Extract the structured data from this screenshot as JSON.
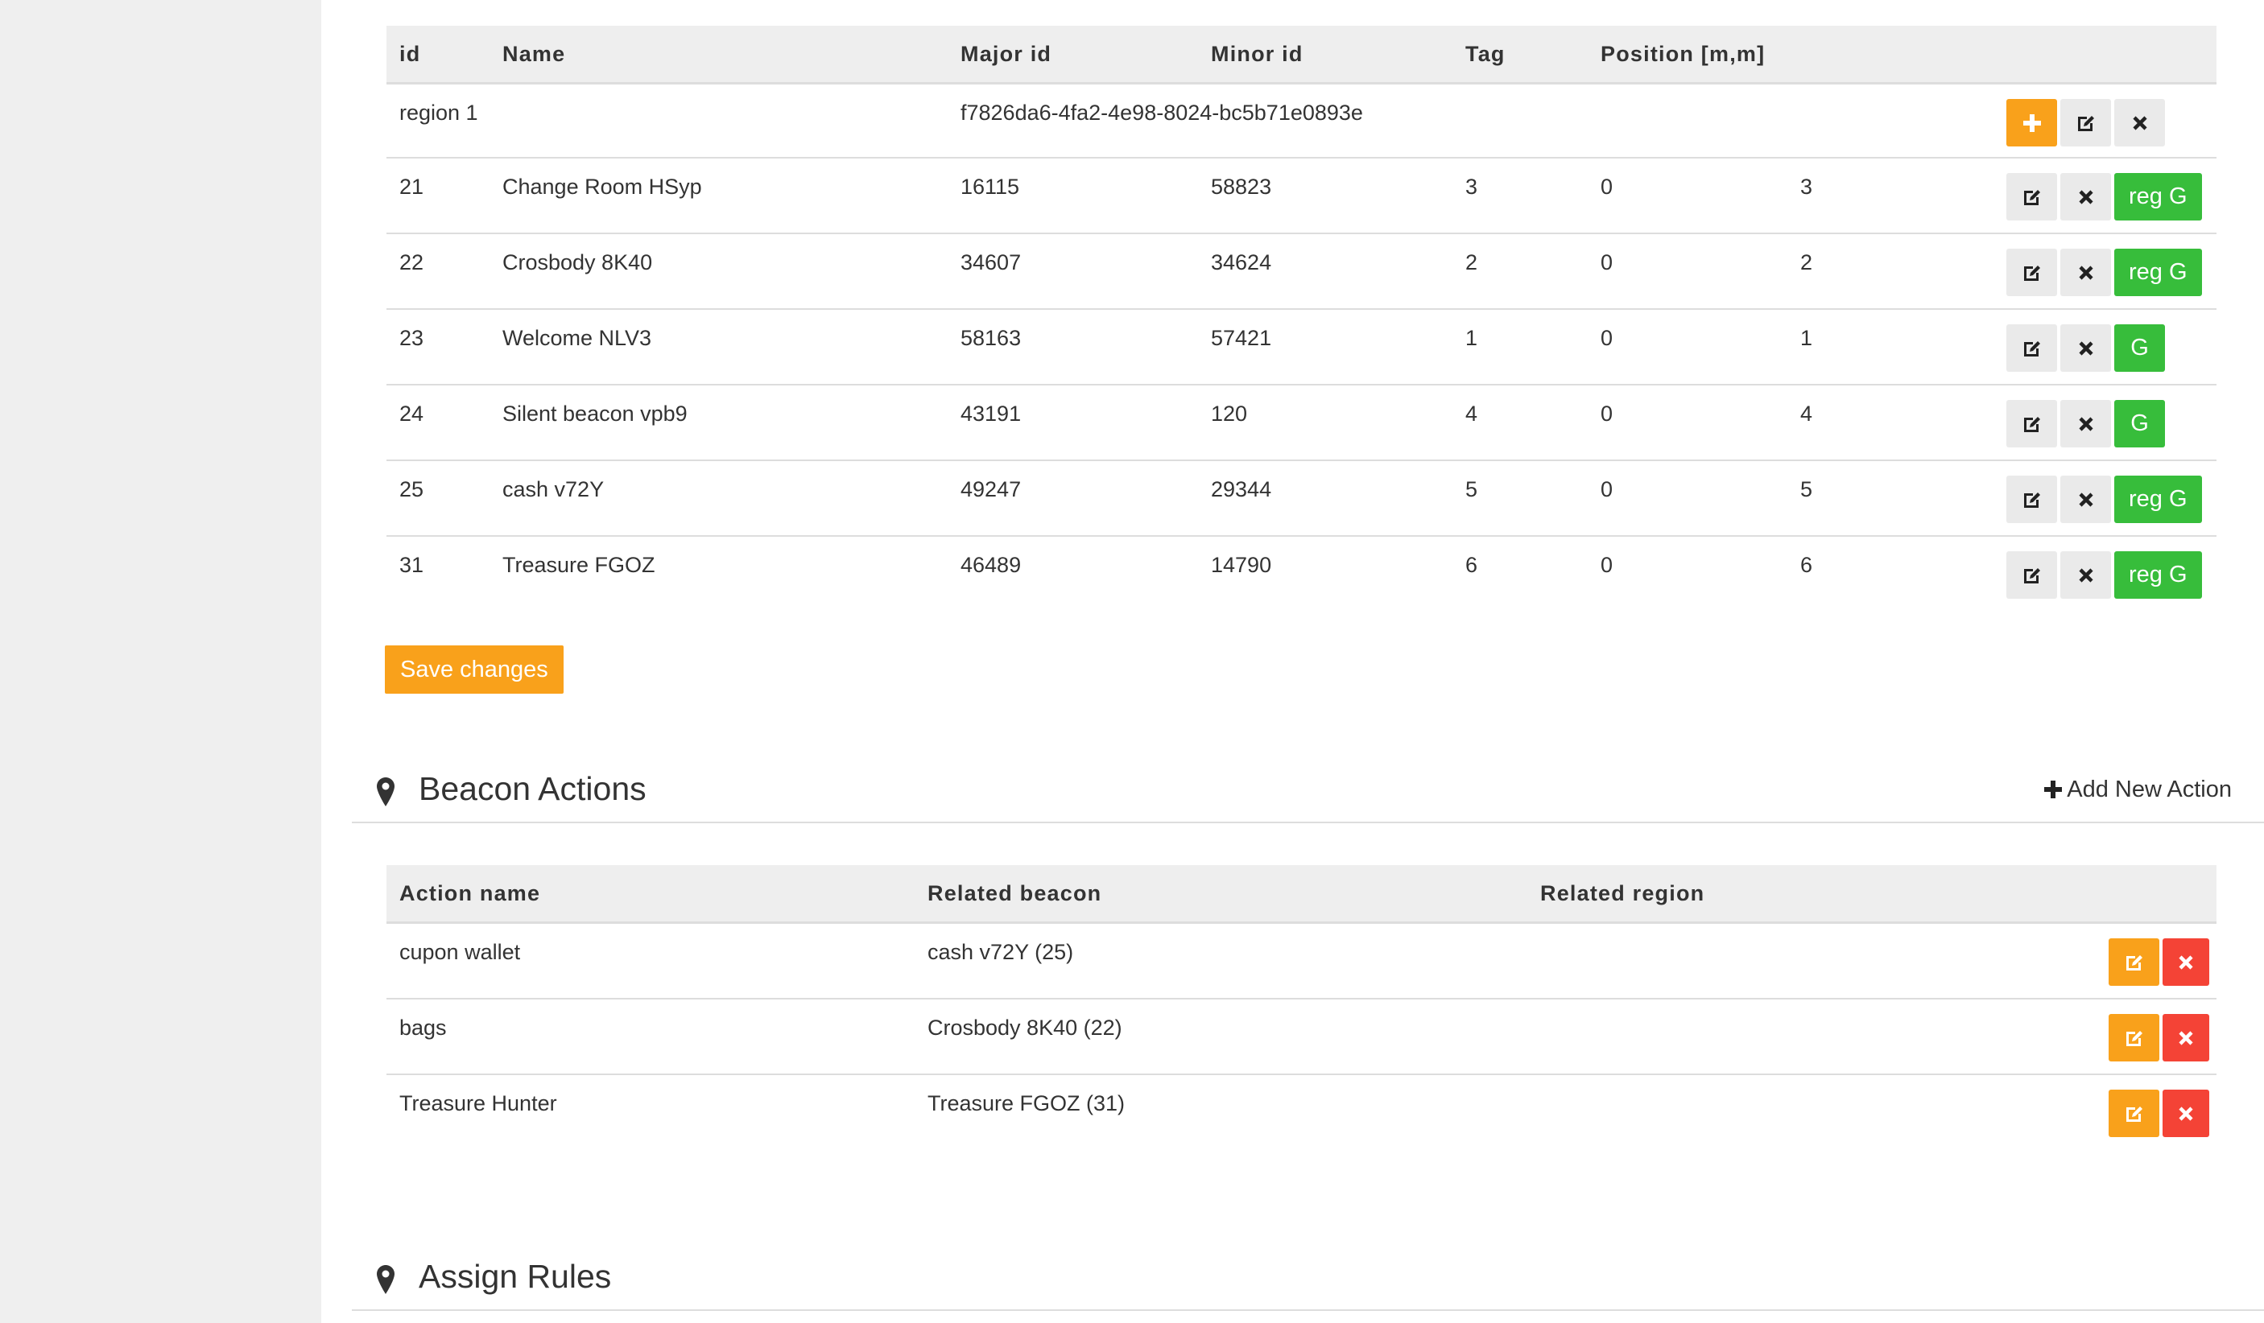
{
  "beacons_table": {
    "headers": {
      "id": "id",
      "name": "Name",
      "major": "Major id",
      "minor": "Minor id",
      "tag": "Tag",
      "position": "Position [m,m]"
    },
    "region_row": {
      "id": "region 1",
      "uuid": "f7826da6-4fa2-4e98-8024-bc5b71e0893e"
    },
    "rows": [
      {
        "id": "21",
        "name": "Change Room HSyp",
        "major": "16115",
        "minor": "58823",
        "tag": "3",
        "pos_x": "0",
        "pos_y": "3",
        "group_label": "reg G"
      },
      {
        "id": "22",
        "name": "Crosbody 8K40",
        "major": "34607",
        "minor": "34624",
        "tag": "2",
        "pos_x": "0",
        "pos_y": "2",
        "group_label": "reg G"
      },
      {
        "id": "23",
        "name": "Welcome NLV3",
        "major": "58163",
        "minor": "57421",
        "tag": "1",
        "pos_x": "0",
        "pos_y": "1",
        "group_label": "G"
      },
      {
        "id": "24",
        "name": "Silent beacon vpb9",
        "major": "43191",
        "minor": "120",
        "tag": "4",
        "pos_x": "0",
        "pos_y": "4",
        "group_label": "G"
      },
      {
        "id": "25",
        "name": "cash v72Y",
        "major": "49247",
        "minor": "29344",
        "tag": "5",
        "pos_x": "0",
        "pos_y": "5",
        "group_label": "reg G"
      },
      {
        "id": "31",
        "name": "Treasure FGOZ",
        "major": "46489",
        "minor": "14790",
        "tag": "6",
        "pos_x": "0",
        "pos_y": "6",
        "group_label": "reg G"
      }
    ]
  },
  "save_button": "Save changes",
  "beacon_actions": {
    "title": "Beacon Actions",
    "add_label": "Add New Action",
    "headers": {
      "action": "Action name",
      "beacon": "Related beacon",
      "region": "Related region"
    },
    "rows": [
      {
        "action": "cupon wallet",
        "beacon": "cash v72Y (25)",
        "region": ""
      },
      {
        "action": "bags",
        "beacon": "Crosbody 8K40 (22)",
        "region": ""
      },
      {
        "action": "Treasure Hunter",
        "beacon": "Treasure FGOZ (31)",
        "region": ""
      }
    ]
  },
  "assign_rules": {
    "title": "Assign Rules"
  },
  "colors": {
    "accent_orange": "#f9a11b",
    "success_green": "#37bd3b",
    "danger_red": "#f44336",
    "sidebar": "#efefef"
  },
  "icons": {
    "add": "plus-icon",
    "edit": "edit-icon",
    "delete": "close-icon",
    "section": "map-marker-icon"
  }
}
